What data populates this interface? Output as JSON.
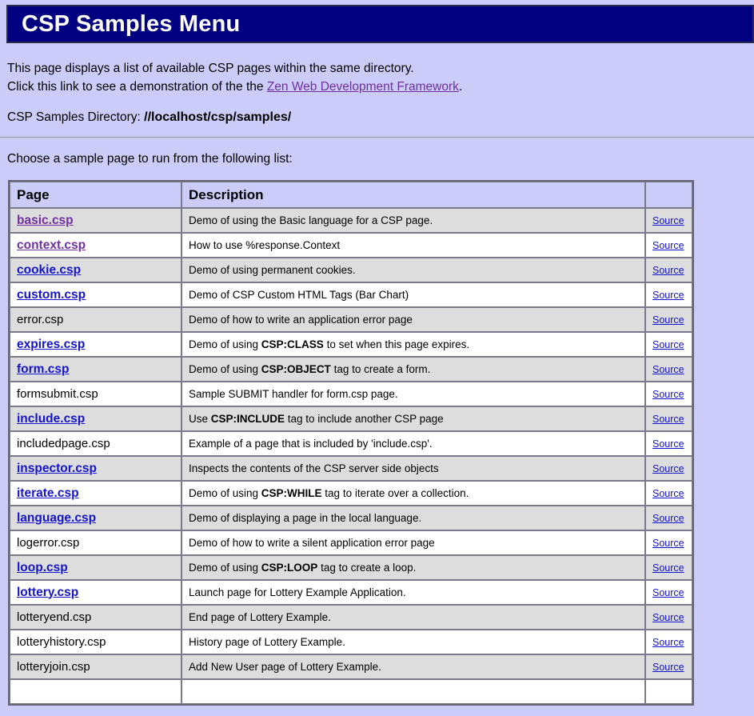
{
  "page": {
    "title": "CSP Samples Menu",
    "intro_line_1": "This page displays a list of available CSP pages within the same directory.",
    "intro_line_2_prefix": "Click this link to see a demonstration of the the ",
    "intro_link_label": "Zen Web Development Framework",
    "intro_line_2_suffix": ".",
    "directory_label": "CSP Samples Directory: ",
    "directory_path": "//localhost/csp/samples/",
    "choose_text": "Choose a sample page to run from the following list:",
    "source_label": "Source"
  },
  "colors": {
    "page_background": "#ccccf8",
    "banner_background": "#000080",
    "banner_border": "#2b2b50",
    "banner_text": "#ffffff",
    "link_unvisited": "#1414cc",
    "link_visited": "#70309f",
    "row_alt_background": "#dddddd",
    "row_plain_background": "#ffffff",
    "table_border": "#666677",
    "cell_border": "#7a7a8c",
    "rule": "#9a9a9a"
  },
  "table": {
    "headers": [
      "Page",
      "Description",
      ""
    ],
    "rows": [
      {
        "page": "basic.csp",
        "is_link": true,
        "visited": true,
        "desc_pre": "Demo of using the Basic language for a CSP page.",
        "desc_bold": "",
        "desc_post": "",
        "source": "Source",
        "shade": "alt"
      },
      {
        "page": "context.csp",
        "is_link": true,
        "visited": true,
        "desc_pre": "How to use %response.Context",
        "desc_bold": "",
        "desc_post": "",
        "source": "Source",
        "shade": "plain"
      },
      {
        "page": "cookie.csp",
        "is_link": true,
        "visited": false,
        "desc_pre": "Demo of using permanent cookies.",
        "desc_bold": "",
        "desc_post": "",
        "source": "Source",
        "shade": "alt"
      },
      {
        "page": "custom.csp",
        "is_link": true,
        "visited": false,
        "desc_pre": "Demo of CSP Custom HTML Tags (Bar Chart)",
        "desc_bold": "",
        "desc_post": "",
        "source": "Source",
        "shade": "plain"
      },
      {
        "page": "error.csp",
        "is_link": false,
        "visited": false,
        "desc_pre": "Demo of how to write an application error page",
        "desc_bold": "",
        "desc_post": "",
        "source": "Source",
        "shade": "alt"
      },
      {
        "page": "expires.csp",
        "is_link": true,
        "visited": false,
        "desc_pre": "Demo of using ",
        "desc_bold": "CSP:CLASS",
        "desc_post": " to set when this page expires.",
        "source": "Source",
        "shade": "plain"
      },
      {
        "page": "form.csp",
        "is_link": true,
        "visited": false,
        "desc_pre": "Demo of using ",
        "desc_bold": "CSP:OBJECT",
        "desc_post": " tag to create a form.",
        "source": "Source",
        "shade": "alt"
      },
      {
        "page": "formsubmit.csp",
        "is_link": false,
        "visited": false,
        "desc_pre": "Sample SUBMIT handler for form.csp page.",
        "desc_bold": "",
        "desc_post": "",
        "source": "Source",
        "shade": "plain"
      },
      {
        "page": "include.csp",
        "is_link": true,
        "visited": false,
        "desc_pre": "Use ",
        "desc_bold": "CSP:INCLUDE",
        "desc_post": " tag to include another CSP page",
        "source": "Source",
        "shade": "alt"
      },
      {
        "page": "includedpage.csp",
        "is_link": false,
        "visited": false,
        "desc_pre": "Example of a page that is included by 'include.csp'.",
        "desc_bold": "",
        "desc_post": "",
        "source": "Source",
        "shade": "plain"
      },
      {
        "page": "inspector.csp",
        "is_link": true,
        "visited": false,
        "desc_pre": "Inspects the contents of the CSP server side objects",
        "desc_bold": "",
        "desc_post": "",
        "source": "Source",
        "shade": "alt"
      },
      {
        "page": "iterate.csp",
        "is_link": true,
        "visited": false,
        "desc_pre": "Demo of using ",
        "desc_bold": "CSP:WHILE",
        "desc_post": " tag to iterate over a collection.",
        "source": "Source",
        "shade": "plain"
      },
      {
        "page": "language.csp",
        "is_link": true,
        "visited": false,
        "desc_pre": "Demo of displaying a page in the local language.",
        "desc_bold": "",
        "desc_post": "",
        "source": "Source",
        "shade": "alt"
      },
      {
        "page": "logerror.csp",
        "is_link": false,
        "visited": false,
        "desc_pre": "Demo of how to write a silent application error page",
        "desc_bold": "",
        "desc_post": "",
        "source": "Source",
        "shade": "plain"
      },
      {
        "page": "loop.csp",
        "is_link": true,
        "visited": false,
        "desc_pre": "Demo of using ",
        "desc_bold": "CSP:LOOP",
        "desc_post": " tag to create a loop.",
        "source": "Source",
        "shade": "alt"
      },
      {
        "page": "lottery.csp",
        "is_link": true,
        "visited": false,
        "desc_pre": "Launch page for Lottery Example Application.",
        "desc_bold": "",
        "desc_post": "",
        "source": "Source",
        "shade": "plain"
      },
      {
        "page": "lotteryend.csp",
        "is_link": false,
        "visited": false,
        "desc_pre": "End page of Lottery Example.",
        "desc_bold": "",
        "desc_post": "",
        "source": "Source",
        "shade": "alt"
      },
      {
        "page": "lotteryhistory.csp",
        "is_link": false,
        "visited": false,
        "desc_pre": "History page of Lottery Example.",
        "desc_bold": "",
        "desc_post": "",
        "source": "Source",
        "shade": "plain"
      },
      {
        "page": "lotteryjoin.csp",
        "is_link": false,
        "visited": false,
        "desc_pre": "Add New User page of Lottery Example.",
        "desc_bold": "",
        "desc_post": "",
        "source": "Source",
        "shade": "alt"
      },
      {
        "page": "",
        "is_link": false,
        "visited": false,
        "desc_pre": "",
        "desc_bold": "",
        "desc_post": "",
        "source": "",
        "shade": "plain"
      }
    ]
  }
}
